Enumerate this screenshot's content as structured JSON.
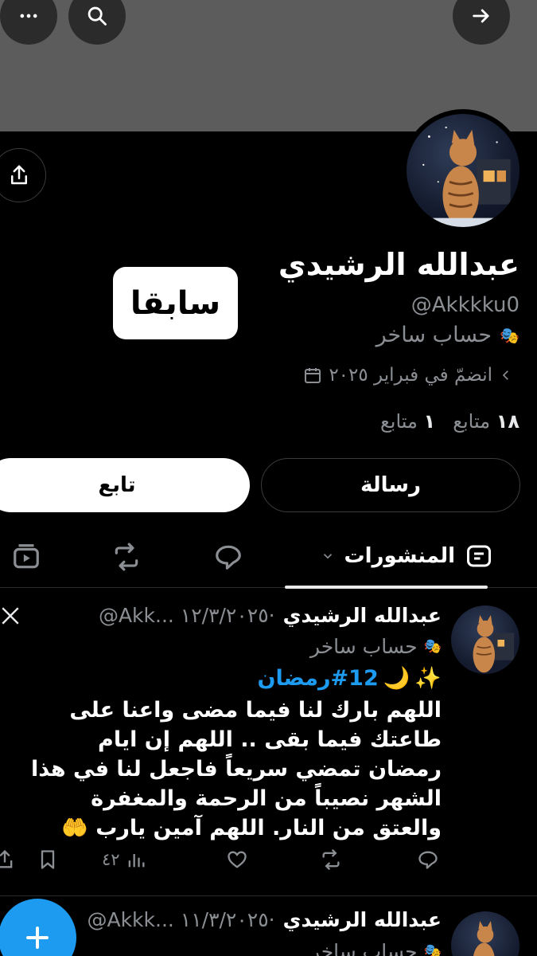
{
  "profile": {
    "name": "عبدالله الرشيدي",
    "handle": "@Akkkku0",
    "bio": "حساب ساخر",
    "joined": "انضمّ في فبراير ٢٠٢٥",
    "followers_count": "١٨",
    "followers_label": "متابع",
    "following_count": "١",
    "following_label": "متابع"
  },
  "sticker_text": "سابقا",
  "buttons": {
    "message": "رسالة",
    "follow": "تابع"
  },
  "tabs": {
    "posts_label": "المنشورات"
  },
  "posts": [
    {
      "name": "عبدالله الرشيدي",
      "meta": "@Akk... ١٢/٣/٢٠٢٥·",
      "bio": "حساب ساخر",
      "hashtag": "#12رمضان",
      "body": "اللهم بارك لنا فيما مضى واعنا على طاعتك فيما بقى .. اللهم إن ايام رمضان تمضي سريعاً فاجعل لنا في هذا الشهر نصيباً من الرحمة والمغفرة والعتق من النار. اللهم آمين يارب 🤲",
      "views": "٤٢"
    },
    {
      "name": "عبدالله الرشيدي",
      "meta": "@Akkk... ١١/٣/٢٠٢٥·",
      "bio": "حساب ساخر"
    }
  ],
  "colors": {
    "accent": "#1d9bf0",
    "banner": "#5c5c5c",
    "muted": "#8b8f94"
  }
}
